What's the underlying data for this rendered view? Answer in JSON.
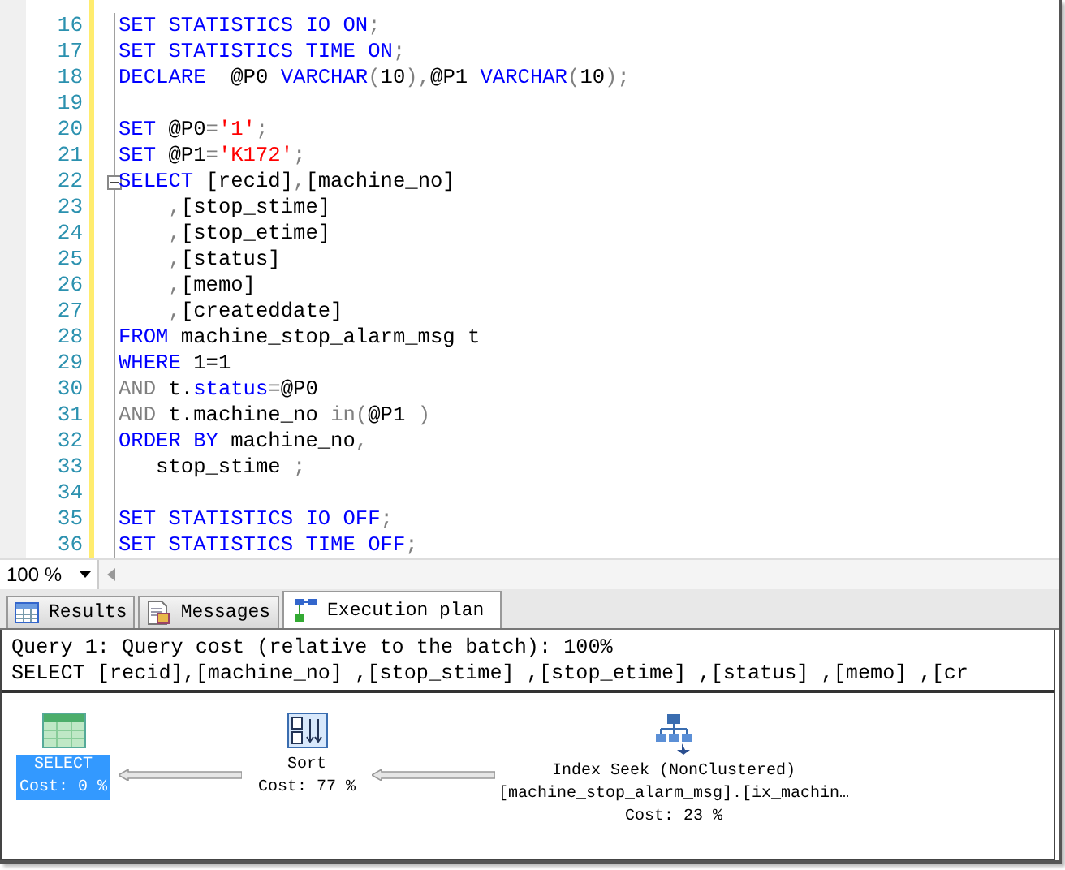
{
  "editor": {
    "lines": [
      {
        "number": "16",
        "tokens": [
          {
            "kind": "kw",
            "text": "SET STATISTICS IO ON"
          },
          {
            "kind": "op",
            "text": ";"
          }
        ]
      },
      {
        "number": "17",
        "tokens": [
          {
            "kind": "kw",
            "text": "SET STATISTICS TIME ON"
          },
          {
            "kind": "op",
            "text": ";"
          }
        ]
      },
      {
        "number": "18",
        "tokens": [
          {
            "kind": "kw",
            "text": "DECLARE"
          },
          {
            "kind": "plain",
            "text": "  @P0 "
          },
          {
            "kind": "kw",
            "text": "VARCHAR"
          },
          {
            "kind": "op",
            "text": "("
          },
          {
            "kind": "plain",
            "text": "10"
          },
          {
            "kind": "op",
            "text": "),"
          },
          {
            "kind": "plain",
            "text": "@P1 "
          },
          {
            "kind": "kw",
            "text": "VARCHAR"
          },
          {
            "kind": "op",
            "text": "("
          },
          {
            "kind": "plain",
            "text": "10"
          },
          {
            "kind": "op",
            "text": ");"
          }
        ]
      },
      {
        "number": "19"
      },
      {
        "number": "20",
        "tokens": [
          {
            "kind": "kw",
            "text": "SET"
          },
          {
            "kind": "plain",
            "text": " @P0"
          },
          {
            "kind": "op",
            "text": "="
          },
          {
            "kind": "str",
            "text": "'1'"
          },
          {
            "kind": "op",
            "text": ";"
          }
        ]
      },
      {
        "number": "21",
        "tokens": [
          {
            "kind": "kw",
            "text": "SET"
          },
          {
            "kind": "plain",
            "text": " @P1"
          },
          {
            "kind": "op",
            "text": "="
          },
          {
            "kind": "str",
            "text": "'K172'"
          },
          {
            "kind": "op",
            "text": ";"
          }
        ]
      },
      {
        "number": "22",
        "fold_start": true,
        "tokens": [
          {
            "kind": "kw",
            "text": "SELECT"
          },
          {
            "kind": "plain",
            "text": " [recid]"
          },
          {
            "kind": "op",
            "text": ","
          },
          {
            "kind": "plain",
            "text": "[machine_no]"
          }
        ]
      },
      {
        "number": "23",
        "tokens": [
          {
            "kind": "op",
            "text": "    ,"
          },
          {
            "kind": "plain",
            "text": "[stop_stime]"
          }
        ]
      },
      {
        "number": "24",
        "tokens": [
          {
            "kind": "op",
            "text": "    ,"
          },
          {
            "kind": "plain",
            "text": "[stop_etime]"
          }
        ]
      },
      {
        "number": "25",
        "tokens": [
          {
            "kind": "op",
            "text": "    ,"
          },
          {
            "kind": "plain",
            "text": "[status]"
          }
        ]
      },
      {
        "number": "26",
        "tokens": [
          {
            "kind": "op",
            "text": "    ,"
          },
          {
            "kind": "plain",
            "text": "[memo]"
          }
        ]
      },
      {
        "number": "27",
        "tokens": [
          {
            "kind": "op",
            "text": "    ,"
          },
          {
            "kind": "plain",
            "text": "[createddate]"
          }
        ]
      },
      {
        "number": "28",
        "tokens": [
          {
            "kind": "kw",
            "text": "FROM"
          },
          {
            "kind": "plain",
            "text": " machine_stop_alarm_msg t"
          }
        ]
      },
      {
        "number": "29",
        "tokens": [
          {
            "kind": "kw",
            "text": "WHERE"
          },
          {
            "kind": "plain",
            "text": " 1=1"
          }
        ]
      },
      {
        "number": "30",
        "tokens": [
          {
            "kind": "op",
            "text": "AND"
          },
          {
            "kind": "plain",
            "text": " t."
          },
          {
            "kind": "kw",
            "text": "status"
          },
          {
            "kind": "op",
            "text": "="
          },
          {
            "kind": "plain",
            "text": "@P0"
          }
        ]
      },
      {
        "number": "31",
        "tokens": [
          {
            "kind": "op",
            "text": "AND"
          },
          {
            "kind": "plain",
            "text": " t.machine_no "
          },
          {
            "kind": "op",
            "text": "in("
          },
          {
            "kind": "plain",
            "text": "@P1 "
          },
          {
            "kind": "op",
            "text": ")"
          }
        ]
      },
      {
        "number": "32",
        "tokens": [
          {
            "kind": "kw",
            "text": "ORDER BY"
          },
          {
            "kind": "plain",
            "text": " machine_no"
          },
          {
            "kind": "op",
            "text": ","
          }
        ]
      },
      {
        "number": "33",
        "tokens": [
          {
            "kind": "plain",
            "text": "   stop_stime "
          },
          {
            "kind": "op",
            "text": ";"
          }
        ]
      },
      {
        "number": "34"
      },
      {
        "number": "35",
        "tokens": [
          {
            "kind": "kw",
            "text": "SET STATISTICS IO OFF"
          },
          {
            "kind": "op",
            "text": ";"
          }
        ]
      },
      {
        "number": "36",
        "tokens": [
          {
            "kind": "kw",
            "text": "SET STATISTICS TIME OFF"
          },
          {
            "kind": "op",
            "text": ";"
          }
        ]
      }
    ]
  },
  "zoom": {
    "value": "100 %"
  },
  "tabs": [
    {
      "label": "Results",
      "selected": false
    },
    {
      "label": "Messages",
      "selected": false
    },
    {
      "label": "Execution plan",
      "selected": true
    }
  ],
  "plan": {
    "header": [
      "Query 1: Query cost (relative to the batch): 100%",
      "SELECT [recid],[machine_no] ,[stop_stime] ,[stop_etime] ,[status] ,[memo] ,[cr"
    ],
    "nodes": [
      {
        "lines": [
          "SELECT",
          "Cost: 0 %"
        ],
        "selected": true
      },
      {
        "lines": [
          "Sort",
          "Cost: 77 %"
        ],
        "selected": false
      },
      {
        "lines": [
          "Index Seek (NonClustered)",
          "[machine_stop_alarm_msg].[ix_machin…",
          "Cost: 23 %"
        ],
        "selected": false
      }
    ]
  }
}
